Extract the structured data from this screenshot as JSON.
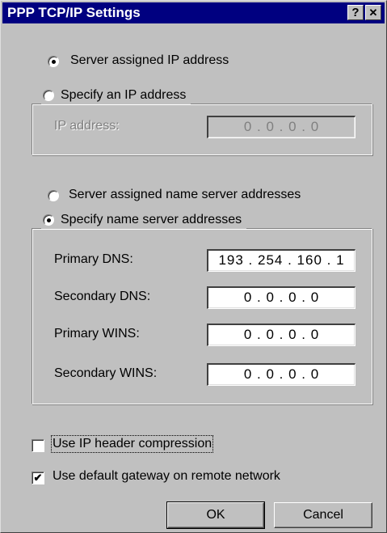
{
  "window": {
    "title": "PPP TCP/IP Settings",
    "help_glyph": "?",
    "close_glyph": "✕"
  },
  "ip_section": {
    "server_assigned": {
      "label": "Server assigned IP address",
      "selected": true
    },
    "specify": {
      "label": "Specify an IP address",
      "selected": false
    },
    "ip_address": {
      "label": "IP address:",
      "value": "0 . 0 . 0 . 0",
      "enabled": false
    }
  },
  "dns_section": {
    "server_assigned": {
      "label": "Server assigned name server addresses",
      "selected": false
    },
    "specify": {
      "label": "Specify name server addresses",
      "selected": true
    },
    "fields": [
      {
        "label": "Primary DNS:",
        "value": "193 . 254 . 160 .  1"
      },
      {
        "label": "Secondary DNS:",
        "value": "0 . 0 . 0 . 0"
      },
      {
        "label": "Primary WINS:",
        "value": "0 . 0 . 0 . 0"
      },
      {
        "label": "Secondary WINS:",
        "value": "0 . 0 . 0 . 0"
      }
    ]
  },
  "options": {
    "ip_header_compression": {
      "label": "Use IP header compression",
      "checked": false
    },
    "default_gateway": {
      "label": "Use default gateway on remote network",
      "checked": true
    }
  },
  "buttons": {
    "ok": "OK",
    "cancel": "Cancel"
  },
  "colors": {
    "titlebar": "#000080",
    "face": "#c0c0c0"
  }
}
